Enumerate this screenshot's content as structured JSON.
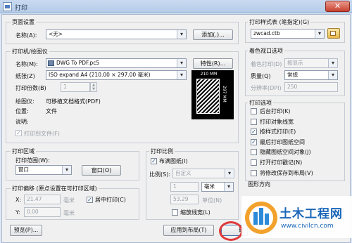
{
  "window": {
    "title": "打印",
    "close_symbol": "✕"
  },
  "page_setup": {
    "legend": "页面设置",
    "name_label": "名称(A):",
    "name_value": "<无>",
    "add_button": "添加(.)..."
  },
  "printer": {
    "legend": "打印机/绘图仪",
    "name_label": "名称(M):",
    "name_value": "DWG To PDF.pc5",
    "properties_button": "特性(R)...",
    "paper_label": "纸张(Z)",
    "paper_value": "ISO expand A4 (210.00 × 297.00 毫米)",
    "copies_label": "打印份数(B)",
    "copies_value": "1",
    "plotter_label": "绘图仪:",
    "plotter_value": "可移植文档格式(PDF)",
    "location_label": "位置:",
    "location_value": "文件",
    "desc_label": "说明:",
    "print_to_file": "打印到文件(F)",
    "preview_width": "210 MM",
    "preview_height": "297 MM"
  },
  "plot_area": {
    "legend": "打印区域",
    "range_label": "打印范围(W):",
    "range_value": "窗口",
    "window_button": "窗口(O)"
  },
  "plot_offset": {
    "legend": "打印偏移 (原点设置在可打印区域)",
    "x_label": "X:",
    "x_value": "21.47",
    "x_unit": "毫米",
    "y_label": "Y:",
    "y_value": "0.00",
    "y_unit": "毫米",
    "center_label": "居中打印(C)"
  },
  "plot_scale": {
    "legend": "打印比例",
    "fit_label": "布满图纸(I)",
    "scale_label": "比例(S):",
    "scale_value": "自定义",
    "value1": "1",
    "unit1": "毫米",
    "value2": "53.29",
    "unit2": "单位(N)",
    "lineweights_label": "缩放线宽(L)"
  },
  "style_table": {
    "legend": "打印样式表 (笔指定)(G)",
    "value": "zwcad.ctb"
  },
  "shaded": {
    "legend": "着色视口选项",
    "shade_label": "着色打印(D)",
    "shade_value": "按显示",
    "quality_label": "质量(Q)",
    "quality_value": "常规",
    "dpi_label": "分辨率(DPI)",
    "dpi_value": "250"
  },
  "options": {
    "legend": "打印选项",
    "items": [
      {
        "label": "后台打印(K)",
        "checked": false
      },
      {
        "label": "打印对象线宽",
        "checked": false
      },
      {
        "label": "按样式打印(E)",
        "checked": true
      },
      {
        "label": "最后打印图纸空间",
        "checked": true
      },
      {
        "label": "隐藏图纸空间对象(J)",
        "checked": false
      },
      {
        "label": "打开打印戳记(N)",
        "checked": false
      },
      {
        "label": "将修改保存到布局(V)",
        "checked": false
      }
    ],
    "orientation_partial": "图形方向"
  },
  "footer": {
    "preview_button": "预览(P)...",
    "apply_button": "应用到布局(T)",
    "ok_partial": "确"
  },
  "watermark": {
    "brand": "土木工程网",
    "url": "www.civilcn.com"
  }
}
